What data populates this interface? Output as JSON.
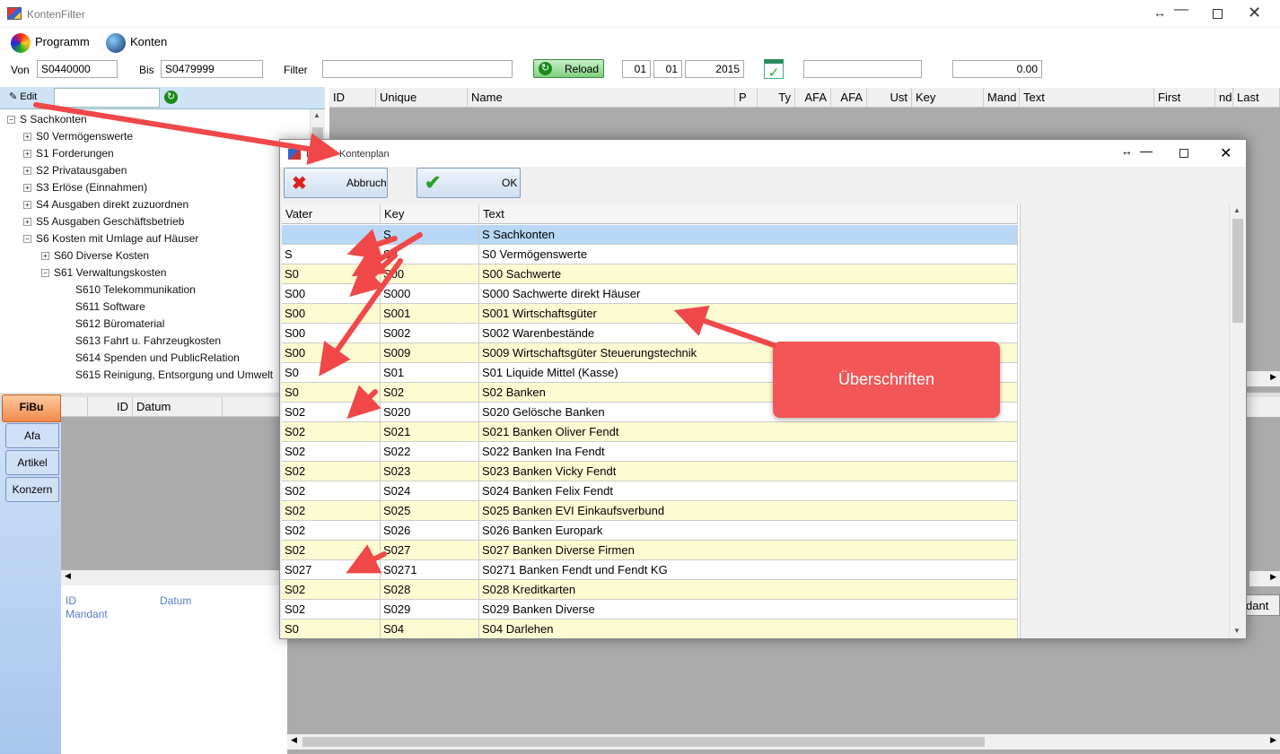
{
  "window": {
    "title": "KontenFilter"
  },
  "menu": {
    "programm": "Programm",
    "konten": "Konten"
  },
  "filterbar": {
    "von_label": "Von",
    "von_value": "S0440000",
    "bis_label": "Bis",
    "bis_value": "S0479999",
    "filter_label": "Filter",
    "filter_value": "",
    "reload_label": "Reload",
    "day": "01",
    "month": "01",
    "year": "2015",
    "text_value": "",
    "amount": "0.00"
  },
  "edit": {
    "label": "Edit"
  },
  "main_grid": {
    "columns": [
      "ID",
      "Unique",
      "Name",
      "P",
      "Ty",
      "AFA",
      "AFA",
      "Ust",
      "Key",
      "Mand",
      "Text",
      "First",
      "nd",
      "Last"
    ]
  },
  "tree": {
    "items": [
      "S Sachkonten",
      "S0 Vermögenswerte",
      "S1 Forderungen",
      "S2 Privatausgaben",
      "S3 Erlöse (Einnahmen)",
      "S4 Ausgaben direkt zuzuordnen",
      "S5 Ausgaben Geschäftsbetrieb",
      "S6 Kosten mit Umlage auf Häuser",
      "S60 Diverse Kosten",
      "S61 Verwaltungskosten",
      "S610 Telekommunikation",
      "S611 Software",
      "S612 Büromaterial",
      "S613 Fahrt u. Fahrzeugkosten",
      "S614 Spenden und PublicRelation",
      "S615 Reinigung, Entsorgung und Umwelt"
    ]
  },
  "tabs": [
    "FiBu",
    "Afa",
    "Artikel",
    "Konzern"
  ],
  "lower_grid": {
    "columns": [
      "ID",
      "Datum"
    ],
    "detail_id": "ID",
    "detail_datum": "Datum",
    "detail_mandant": "Mandant",
    "right_fragment": "dant"
  },
  "dialog": {
    "title": "Kontenplan",
    "title_prefix": "BB",
    "cancel": "Abbruch",
    "ok": "OK",
    "columns": [
      "Vater",
      "Key",
      "Text"
    ],
    "rows": [
      [
        "",
        "S",
        "S Sachkonten"
      ],
      [
        "S",
        "S0",
        "S0 Vermögenswerte"
      ],
      [
        "S0",
        "S00",
        "S00 Sachwerte"
      ],
      [
        "S00",
        "S000",
        "S000 Sachwerte direkt Häuser"
      ],
      [
        "S00",
        "S001",
        "S001 Wirtschaftsgüter"
      ],
      [
        "S00",
        "S002",
        "S002 Warenbestände"
      ],
      [
        "S00",
        "S009",
        "S009 Wirtschaftsgüter Steuerungstechnik"
      ],
      [
        "S0",
        "S01",
        "S01 Liquide Mittel (Kasse)"
      ],
      [
        "S0",
        "S02",
        "S02 Banken"
      ],
      [
        "S02",
        "S020",
        "S020 Gelösche Banken"
      ],
      [
        "S02",
        "S021",
        "S021 Banken Oliver Fendt"
      ],
      [
        "S02",
        "S022",
        "S022 Banken Ina Fendt"
      ],
      [
        "S02",
        "S023",
        "S023 Banken Vicky Fendt"
      ],
      [
        "S02",
        "S024",
        "S024 Banken Felix Fendt"
      ],
      [
        "S02",
        "S025",
        "S025 Banken EVI Einkaufsverbund"
      ],
      [
        "S02",
        "S026",
        "S026 Banken Europark"
      ],
      [
        "S02",
        "S027",
        "S027 Banken Diverse Firmen"
      ],
      [
        "S027",
        "S0271",
        "S0271 Banken Fendt und Fendt KG"
      ],
      [
        "S02",
        "S028",
        "S028 Kreditkarten"
      ],
      [
        "S02",
        "S029",
        "S029 Banken Diverse"
      ],
      [
        "S0",
        "S04",
        "S04 Darlehen"
      ]
    ]
  },
  "annotation": {
    "callout": "Überschriften"
  },
  "colors": {
    "selected_row": "#b9d7f7",
    "yellow_row": "#fdfbd2",
    "callout": "#f25656",
    "arrow": "#f04848"
  }
}
